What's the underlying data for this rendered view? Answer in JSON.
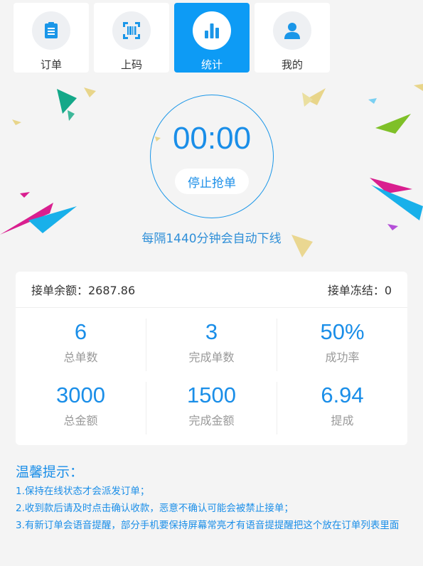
{
  "nav": {
    "items": [
      {
        "label": "订单",
        "icon": "order-list-icon",
        "active": false
      },
      {
        "label": "上码",
        "icon": "qrcode-icon",
        "active": false
      },
      {
        "label": "统计",
        "icon": "bar-chart-icon",
        "active": true
      },
      {
        "label": "我的",
        "icon": "user-icon",
        "active": false
      }
    ]
  },
  "timer": {
    "time": "00:00",
    "stop_label": "停止抢单",
    "auto_offline": "每隔1440分钟会自动下线"
  },
  "stats": {
    "balance_label": "接单余额：2687.86",
    "frozen_label": "接单冻结：0",
    "cells": [
      {
        "value": "6",
        "label": "总单数"
      },
      {
        "value": "3",
        "label": "完成单数"
      },
      {
        "value": "50%",
        "label": "成功率"
      },
      {
        "value": "3000",
        "label": "总金额"
      },
      {
        "value": "1500",
        "label": "完成金额"
      },
      {
        "value": "6.94",
        "label": "提成"
      }
    ]
  },
  "tips": {
    "title": "温馨提示：",
    "lines": [
      "1.保持在线状态才会派发订单；",
      "2.收到款后请及时点击确认收款，恶意不确认可能会被禁止接单；",
      "3.有新订单会语音提醒，部分手机要保持屏幕常亮才有语音提提醒把这个放在订单列表里面"
    ]
  },
  "colors": {
    "accent": "#0d9bf5",
    "text": "#333333",
    "muted": "#999999"
  }
}
